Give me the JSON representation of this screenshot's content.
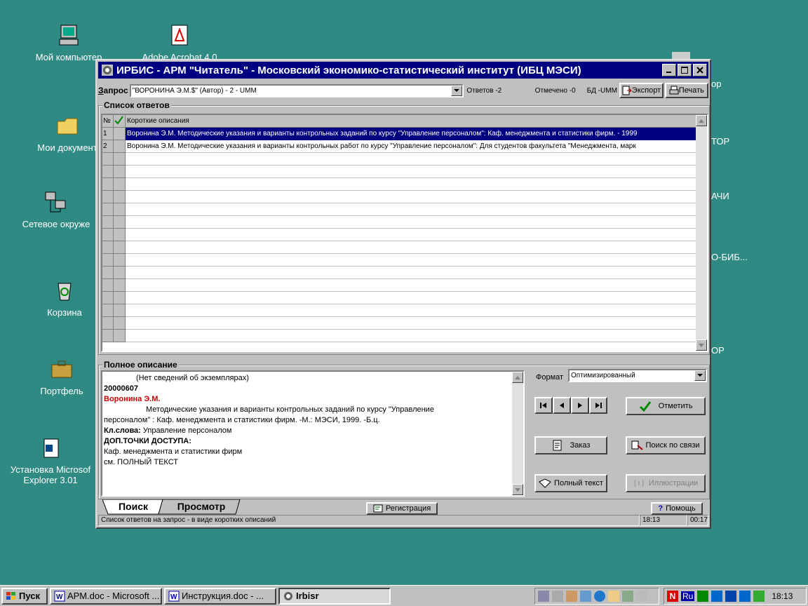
{
  "desktop": {
    "icons": [
      {
        "label": "Мой компьютер"
      },
      {
        "label": "Adobe Acrobat 4.0"
      },
      {
        "label": "Мои документ"
      },
      {
        "label": "Сетевое окруже"
      },
      {
        "label": "Корзина"
      },
      {
        "label": "Портфель"
      },
      {
        "label": "Установка Microsof"
      },
      {
        "label": "Explorer 3.01"
      }
    ],
    "edge_labels": [
      "ор",
      "ТОР",
      "АЧИ",
      "О-БИБ...",
      "ОР"
    ]
  },
  "window": {
    "title": "ИРБИС - АРМ \"Читатель\" - Московский экономико-статистический институт (ИБЦ МЭСИ)",
    "query": {
      "label_hot": "З",
      "label_rest": "апрос",
      "value": "\"ВОРОНИНА  Э.М.$\" (Автор) - 2 - UMM",
      "answers": "Ответов -2",
      "marked": "Отмечено -0",
      "db": "БД -UMM",
      "export_label": "Экспорт",
      "print_label": "Печать"
    },
    "answers_group": {
      "title": "Список ответов",
      "col_no": "№",
      "col_desc": "Короткие описания",
      "rows": [
        {
          "no": "1",
          "text": "Воронина  Э.М. Методические указания и варианты контрольных заданий по курсу \"Управление персоналом\": Каф. менеджмента и статистики фирм. - 1999"
        },
        {
          "no": "2",
          "text": "Воронина  Э.М. Методические указания и варианты контрольных работ по курсу \"Управление персоналом\": Для студентов факультета \"Менеджмента, марк"
        }
      ]
    },
    "full_desc": {
      "title": "Полное описание",
      "line1": "(Нет сведений об экземплярах)",
      "line2": "20000607",
      "author": "Воронина  Э.М.",
      "line4": "Методические указания и варианты контрольных заданий по курсу \"Управление",
      "line5": "персоналом\" : Каф. менеджмента и статистики фирм. -М.: МЭСИ, 1999. -Б.ц.",
      "kw_label": "Кл.слова:",
      "kw_value": " Управление персоналом",
      "extra_label": "ДОП.ТОЧКИ ДОСТУПА:",
      "line8": "Каф. менеджмента и статистики фирм",
      "line9": "см. ПОЛНЫЙ ТЕКСТ"
    },
    "controls": {
      "format_label": "Формат",
      "format_value": "Оптимизированный",
      "mark_label": "Отметить",
      "order_label": "Заказ",
      "search_link_label": "Поиск по связи",
      "fulltext_label": "Полный текст",
      "illus_label": "Иллюстрации"
    },
    "tabs": {
      "search": "Поиск",
      "browse": "Просмотр"
    },
    "register_label": "Регистрация",
    "help_label": "Помощь",
    "status": {
      "text": "Список ответов на запрос - в виде коротких описаний",
      "time1": "18:13",
      "time2": "00:17"
    }
  },
  "taskbar": {
    "start": "Пуск",
    "tasks": [
      {
        "label": "АРМ.doc - Microsoft ..."
      },
      {
        "label": "Инструкция.doc - ..."
      },
      {
        "label": "Irbisr"
      }
    ],
    "lang": "Ru",
    "clock": "18:13"
  },
  "colors": {
    "desktop": "#2f8a84",
    "title_active": "#000080",
    "selection": "#000080",
    "author_red": "#d00000"
  }
}
